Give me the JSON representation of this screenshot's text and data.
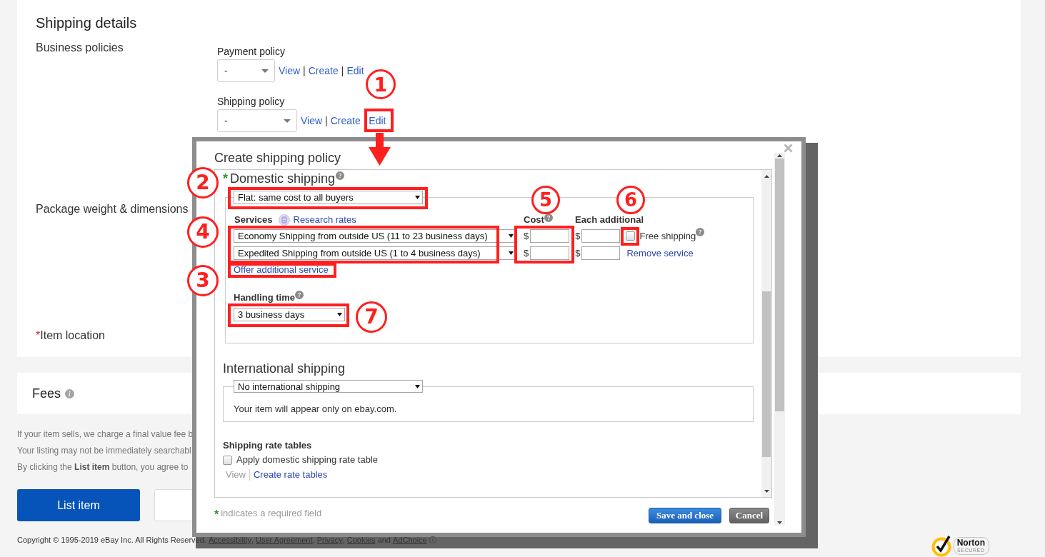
{
  "listing": {
    "shipping_details": {
      "title": "Shipping details",
      "business_policies_label": "Business policies",
      "policies": [
        {
          "label": "Payment policy",
          "value": "-",
          "links": [
            {
              "label": "View"
            },
            {
              "label": "Create",
              "separator": "|"
            },
            {
              "label": "Edit",
              "separator": "|"
            }
          ]
        },
        {
          "label": "Shipping policy",
          "value": "-",
          "links": [
            {
              "label": "View"
            },
            {
              "label": "Create",
              "separator": "|"
            },
            {
              "label": "Edit"
            }
          ]
        }
      ],
      "package_label": "Package weight & dimensions",
      "item_location": {
        "required_mark": "*",
        "label": "Item location"
      }
    },
    "fees": {
      "title": "Fees"
    },
    "notices": [
      "If your item sells, we charge a final value fee b",
      "Your listing may not be immediately searchabl",
      "By clicking the **List item** button, you agree to"
    ],
    "primary_button": "List item",
    "footer": {
      "parts": [
        {
          "kind": "text",
          "text": "Copyright © 1995-2019 eBay Inc. All Rights Reserved."
        },
        {
          "kind": "link",
          "text": "Accessibility",
          "suffix": ","
        },
        {
          "kind": "link",
          "text": "User Agreement",
          "suffix": ","
        },
        {
          "kind": "link",
          "text": "Privacy",
          "suffix": ","
        },
        {
          "kind": "link",
          "text": "Cookies"
        },
        {
          "kind": "text",
          "text": "and"
        },
        {
          "kind": "link",
          "text": "AdChoice"
        }
      ]
    },
    "seal": {
      "name": "Norton",
      "tagline": "SECURED"
    }
  },
  "dialog": {
    "title": "Create shipping policy",
    "domestic": {
      "required_mark": "*",
      "title": "Domestic shipping",
      "cost_type": "Flat: same cost to all buyers",
      "columns": {
        "services": "Services",
        "research_link": "Research rates",
        "cost": "Cost",
        "additional": "Each additional"
      },
      "services": [
        {
          "name": "Economy Shipping from outside US (11 to 23 business days)",
          "cost_currency": "$",
          "additional_currency": "$",
          "free_shipping": {
            "label": "Free shipping",
            "checked": false
          }
        },
        {
          "name": "Expedited Shipping from outside US (1 to 4 business days)",
          "cost_currency": "$",
          "additional_currency": "$",
          "remove_link": "Remove service"
        }
      ],
      "offer_link": "Offer additional service",
      "handling_label": "Handling time",
      "handling_time": "3 business days"
    },
    "international": {
      "title": "International shipping",
      "option": "No international shipping",
      "note": "Your item will appear only on ebay.com."
    },
    "rate_tables": {
      "title": "Shipping rate tables",
      "checkbox": {
        "label": "Apply domestic shipping rate table",
        "checked": false
      },
      "links": [
        {
          "label": "View",
          "disabled": true
        },
        {
          "label": "Create rate tables",
          "disabled": false
        }
      ]
    },
    "required_note": {
      "mark": "*",
      "text": "indicates a required field"
    },
    "buttons": [
      {
        "label": "Save and close",
        "kind": "primary"
      },
      {
        "label": "Cancel",
        "kind": "secondary"
      }
    ]
  },
  "annotations": {
    "markers": [
      {
        "label": "1"
      },
      {
        "label": "2"
      },
      {
        "label": "5"
      },
      {
        "label": "6"
      },
      {
        "label": "4"
      },
      {
        "label": "3"
      },
      {
        "label": "7"
      }
    ]
  }
}
